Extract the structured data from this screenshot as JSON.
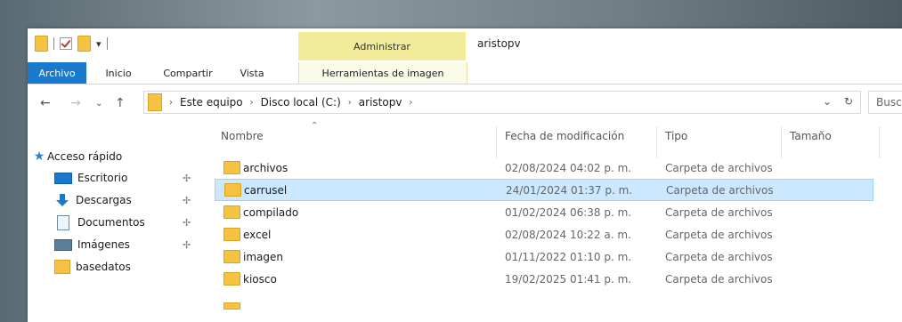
{
  "window": {
    "title": "aristopv"
  },
  "ribbon": {
    "contextual_group": "Administrar",
    "tabs": [
      "Archivo",
      "Inicio",
      "Compartir",
      "Vista",
      "Herramientas de imagen"
    ]
  },
  "address": {
    "breadcrumbs": [
      "Este equipo",
      "Disco local (C:)",
      "aristopv"
    ],
    "search_placeholder": "Busc"
  },
  "nav": {
    "quick_access": "Acceso rápido",
    "items": [
      {
        "label": "Escritorio",
        "icon": "desktop-icon",
        "pinned": true
      },
      {
        "label": "Descargas",
        "icon": "downloads-icon",
        "pinned": true
      },
      {
        "label": "Documentos",
        "icon": "documents-icon",
        "pinned": true
      },
      {
        "label": "Imágenes",
        "icon": "pictures-icon",
        "pinned": true
      },
      {
        "label": "basedatos",
        "icon": "folder-icon",
        "pinned": false
      }
    ]
  },
  "list": {
    "columns": [
      "Nombre",
      "Fecha de modificación",
      "Tipo",
      "Tamaño"
    ],
    "rows": [
      {
        "name": "archivos",
        "date": "02/08/2024 04:02 p. m.",
        "type": "Carpeta de archivos"
      },
      {
        "name": "carrusel",
        "date": "24/01/2024 01:37 p. m.",
        "type": "Carpeta de archivos",
        "selected": true
      },
      {
        "name": "compilado",
        "date": "01/02/2024 06:38 p. m.",
        "type": "Carpeta de archivos"
      },
      {
        "name": "excel",
        "date": "02/08/2024 10:22 a. m.",
        "type": "Carpeta de archivos"
      },
      {
        "name": "imagen",
        "date": "01/11/2022 01:10 p. m.",
        "type": "Carpeta de archivos"
      },
      {
        "name": "kiosco",
        "date": "19/02/2025 01:41 p. m.",
        "type": "Carpeta de archivos"
      }
    ]
  },
  "colors": {
    "accent": "#1979ca",
    "selection": "#cce8ff",
    "contextual": "#f2ec9a",
    "folder": "#f5c242"
  }
}
